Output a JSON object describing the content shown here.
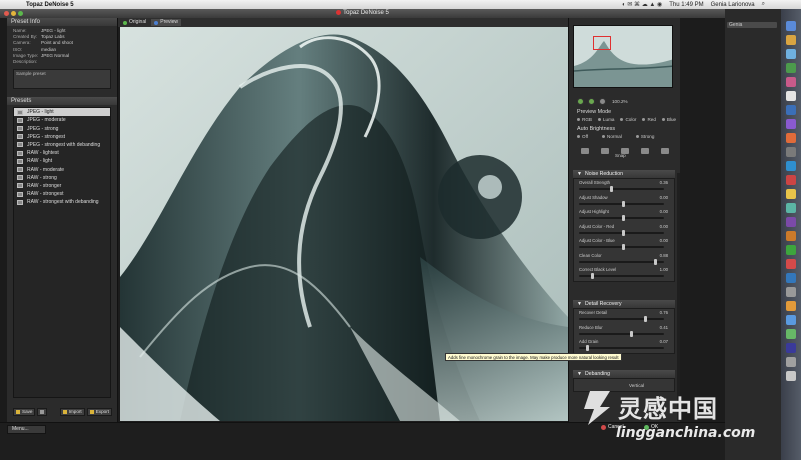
{
  "menubar": {
    "app_name": "Topaz DeNoise 5",
    "time": "Thu 1:49 PM",
    "user": "Genia Larionova"
  },
  "window": {
    "title": "Topaz DeNoise 5"
  },
  "desktop": {
    "field_text": "Genia"
  },
  "preset_info": {
    "header": "Preset Info",
    "rows": [
      {
        "k": "Name:",
        "v": "JPEG - light"
      },
      {
        "k": "Created By:",
        "v": "Topaz Labs"
      },
      {
        "k": "Camera:",
        "v": "Point and shoot"
      },
      {
        "k": "ISO:",
        "v": "median"
      },
      {
        "k": "Image Type:",
        "v": "JPEG Normal"
      },
      {
        "k": "Description:",
        "v": ""
      }
    ],
    "description": "Sample preset"
  },
  "presets": {
    "header": "Presets",
    "items": [
      "JPEG - light",
      "JPEG - moderate",
      "JPEG - strong",
      "JPEG - strongest",
      "JPEG - strongest with debanding",
      "RAW - lightest",
      "RAW - light",
      "RAW - moderate",
      "RAW - strong",
      "RAW - stronger",
      "RAW - strongest",
      "RAW - strongest with debanding"
    ],
    "buttons": {
      "save": "Save",
      "import": "Import",
      "export": "Export"
    }
  },
  "view_tabs": {
    "original": "Original",
    "preview": "Preview"
  },
  "navigator": {
    "zoom": "100.2%"
  },
  "preview_mode": {
    "label": "Preview Mode",
    "options": [
      "RGB",
      "Luma",
      "Color",
      "Red",
      "Blue"
    ]
  },
  "auto_brightness": {
    "label": "Auto Brightness",
    "options": [
      "Off",
      "Normal",
      "Strong"
    ]
  },
  "snap_label": "Snap",
  "noise_reduction": {
    "header": "Noise Reduction",
    "sliders": [
      {
        "name": "Overall Strength",
        "value": "0.36",
        "pos": 0.36
      },
      {
        "name": "Adjust Shadow",
        "value": "0.00",
        "pos": 0.5
      },
      {
        "name": "Adjust Highlight",
        "value": "0.00",
        "pos": 0.5
      },
      {
        "name": "Adjust Color - Red",
        "value": "0.00",
        "pos": 0.5
      },
      {
        "name": "Adjust Color - Blue",
        "value": "0.00",
        "pos": 0.5
      },
      {
        "name": "Clean Color",
        "value": "0.88",
        "pos": 0.88
      },
      {
        "name": "Correct Black Level",
        "value": "1.00",
        "pos": 0.14
      }
    ]
  },
  "detail_recovery": {
    "header": "Detail Recovery",
    "sliders": [
      {
        "name": "Recover Detail",
        "value": "0.76",
        "pos": 0.76
      },
      {
        "name": "Reduce Blur",
        "value": "0.41",
        "pos": 0.6
      },
      {
        "name": "Add Grain",
        "value": "0.07",
        "pos": 0.08
      }
    ]
  },
  "debanding": {
    "header": "Debanding",
    "option": "Vertical"
  },
  "tooltip": "Adds fine monochrome grain to the image. May make produce more natural looking result",
  "actions": {
    "menu": "Menu...",
    "cancel": "Cancel",
    "ok": "OK"
  },
  "watermark": {
    "cn": "灵感中国",
    "url": "lingganchina.com"
  }
}
